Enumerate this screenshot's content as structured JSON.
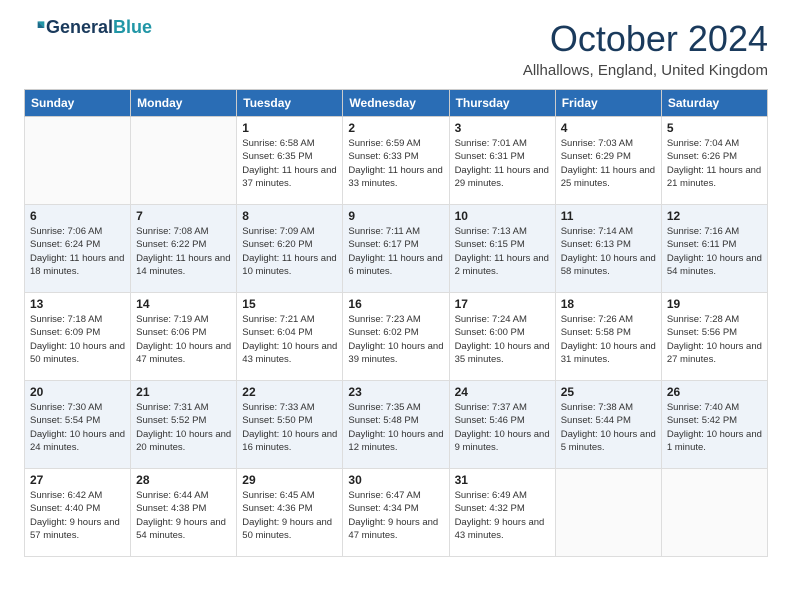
{
  "header": {
    "logo_line1": "General",
    "logo_line2": "Blue",
    "month_year": "October 2024",
    "location": "Allhallows, England, United Kingdom"
  },
  "days_of_week": [
    "Sunday",
    "Monday",
    "Tuesday",
    "Wednesday",
    "Thursday",
    "Friday",
    "Saturday"
  ],
  "weeks": [
    [
      {
        "day": "",
        "sunrise": "",
        "sunset": "",
        "daylight": ""
      },
      {
        "day": "",
        "sunrise": "",
        "sunset": "",
        "daylight": ""
      },
      {
        "day": "1",
        "sunrise": "Sunrise: 6:58 AM",
        "sunset": "Sunset: 6:35 PM",
        "daylight": "Daylight: 11 hours and 37 minutes."
      },
      {
        "day": "2",
        "sunrise": "Sunrise: 6:59 AM",
        "sunset": "Sunset: 6:33 PM",
        "daylight": "Daylight: 11 hours and 33 minutes."
      },
      {
        "day": "3",
        "sunrise": "Sunrise: 7:01 AM",
        "sunset": "Sunset: 6:31 PM",
        "daylight": "Daylight: 11 hours and 29 minutes."
      },
      {
        "day": "4",
        "sunrise": "Sunrise: 7:03 AM",
        "sunset": "Sunset: 6:29 PM",
        "daylight": "Daylight: 11 hours and 25 minutes."
      },
      {
        "day": "5",
        "sunrise": "Sunrise: 7:04 AM",
        "sunset": "Sunset: 6:26 PM",
        "daylight": "Daylight: 11 hours and 21 minutes."
      }
    ],
    [
      {
        "day": "6",
        "sunrise": "Sunrise: 7:06 AM",
        "sunset": "Sunset: 6:24 PM",
        "daylight": "Daylight: 11 hours and 18 minutes."
      },
      {
        "day": "7",
        "sunrise": "Sunrise: 7:08 AM",
        "sunset": "Sunset: 6:22 PM",
        "daylight": "Daylight: 11 hours and 14 minutes."
      },
      {
        "day": "8",
        "sunrise": "Sunrise: 7:09 AM",
        "sunset": "Sunset: 6:20 PM",
        "daylight": "Daylight: 11 hours and 10 minutes."
      },
      {
        "day": "9",
        "sunrise": "Sunrise: 7:11 AM",
        "sunset": "Sunset: 6:17 PM",
        "daylight": "Daylight: 11 hours and 6 minutes."
      },
      {
        "day": "10",
        "sunrise": "Sunrise: 7:13 AM",
        "sunset": "Sunset: 6:15 PM",
        "daylight": "Daylight: 11 hours and 2 minutes."
      },
      {
        "day": "11",
        "sunrise": "Sunrise: 7:14 AM",
        "sunset": "Sunset: 6:13 PM",
        "daylight": "Daylight: 10 hours and 58 minutes."
      },
      {
        "day": "12",
        "sunrise": "Sunrise: 7:16 AM",
        "sunset": "Sunset: 6:11 PM",
        "daylight": "Daylight: 10 hours and 54 minutes."
      }
    ],
    [
      {
        "day": "13",
        "sunrise": "Sunrise: 7:18 AM",
        "sunset": "Sunset: 6:09 PM",
        "daylight": "Daylight: 10 hours and 50 minutes."
      },
      {
        "day": "14",
        "sunrise": "Sunrise: 7:19 AM",
        "sunset": "Sunset: 6:06 PM",
        "daylight": "Daylight: 10 hours and 47 minutes."
      },
      {
        "day": "15",
        "sunrise": "Sunrise: 7:21 AM",
        "sunset": "Sunset: 6:04 PM",
        "daylight": "Daylight: 10 hours and 43 minutes."
      },
      {
        "day": "16",
        "sunrise": "Sunrise: 7:23 AM",
        "sunset": "Sunset: 6:02 PM",
        "daylight": "Daylight: 10 hours and 39 minutes."
      },
      {
        "day": "17",
        "sunrise": "Sunrise: 7:24 AM",
        "sunset": "Sunset: 6:00 PM",
        "daylight": "Daylight: 10 hours and 35 minutes."
      },
      {
        "day": "18",
        "sunrise": "Sunrise: 7:26 AM",
        "sunset": "Sunset: 5:58 PM",
        "daylight": "Daylight: 10 hours and 31 minutes."
      },
      {
        "day": "19",
        "sunrise": "Sunrise: 7:28 AM",
        "sunset": "Sunset: 5:56 PM",
        "daylight": "Daylight: 10 hours and 27 minutes."
      }
    ],
    [
      {
        "day": "20",
        "sunrise": "Sunrise: 7:30 AM",
        "sunset": "Sunset: 5:54 PM",
        "daylight": "Daylight: 10 hours and 24 minutes."
      },
      {
        "day": "21",
        "sunrise": "Sunrise: 7:31 AM",
        "sunset": "Sunset: 5:52 PM",
        "daylight": "Daylight: 10 hours and 20 minutes."
      },
      {
        "day": "22",
        "sunrise": "Sunrise: 7:33 AM",
        "sunset": "Sunset: 5:50 PM",
        "daylight": "Daylight: 10 hours and 16 minutes."
      },
      {
        "day": "23",
        "sunrise": "Sunrise: 7:35 AM",
        "sunset": "Sunset: 5:48 PM",
        "daylight": "Daylight: 10 hours and 12 minutes."
      },
      {
        "day": "24",
        "sunrise": "Sunrise: 7:37 AM",
        "sunset": "Sunset: 5:46 PM",
        "daylight": "Daylight: 10 hours and 9 minutes."
      },
      {
        "day": "25",
        "sunrise": "Sunrise: 7:38 AM",
        "sunset": "Sunset: 5:44 PM",
        "daylight": "Daylight: 10 hours and 5 minutes."
      },
      {
        "day": "26",
        "sunrise": "Sunrise: 7:40 AM",
        "sunset": "Sunset: 5:42 PM",
        "daylight": "Daylight: 10 hours and 1 minute."
      }
    ],
    [
      {
        "day": "27",
        "sunrise": "Sunrise: 6:42 AM",
        "sunset": "Sunset: 4:40 PM",
        "daylight": "Daylight: 9 hours and 57 minutes."
      },
      {
        "day": "28",
        "sunrise": "Sunrise: 6:44 AM",
        "sunset": "Sunset: 4:38 PM",
        "daylight": "Daylight: 9 hours and 54 minutes."
      },
      {
        "day": "29",
        "sunrise": "Sunrise: 6:45 AM",
        "sunset": "Sunset: 4:36 PM",
        "daylight": "Daylight: 9 hours and 50 minutes."
      },
      {
        "day": "30",
        "sunrise": "Sunrise: 6:47 AM",
        "sunset": "Sunset: 4:34 PM",
        "daylight": "Daylight: 9 hours and 47 minutes."
      },
      {
        "day": "31",
        "sunrise": "Sunrise: 6:49 AM",
        "sunset": "Sunset: 4:32 PM",
        "daylight": "Daylight: 9 hours and 43 minutes."
      },
      {
        "day": "",
        "sunrise": "",
        "sunset": "",
        "daylight": ""
      },
      {
        "day": "",
        "sunrise": "",
        "sunset": "",
        "daylight": ""
      }
    ]
  ]
}
